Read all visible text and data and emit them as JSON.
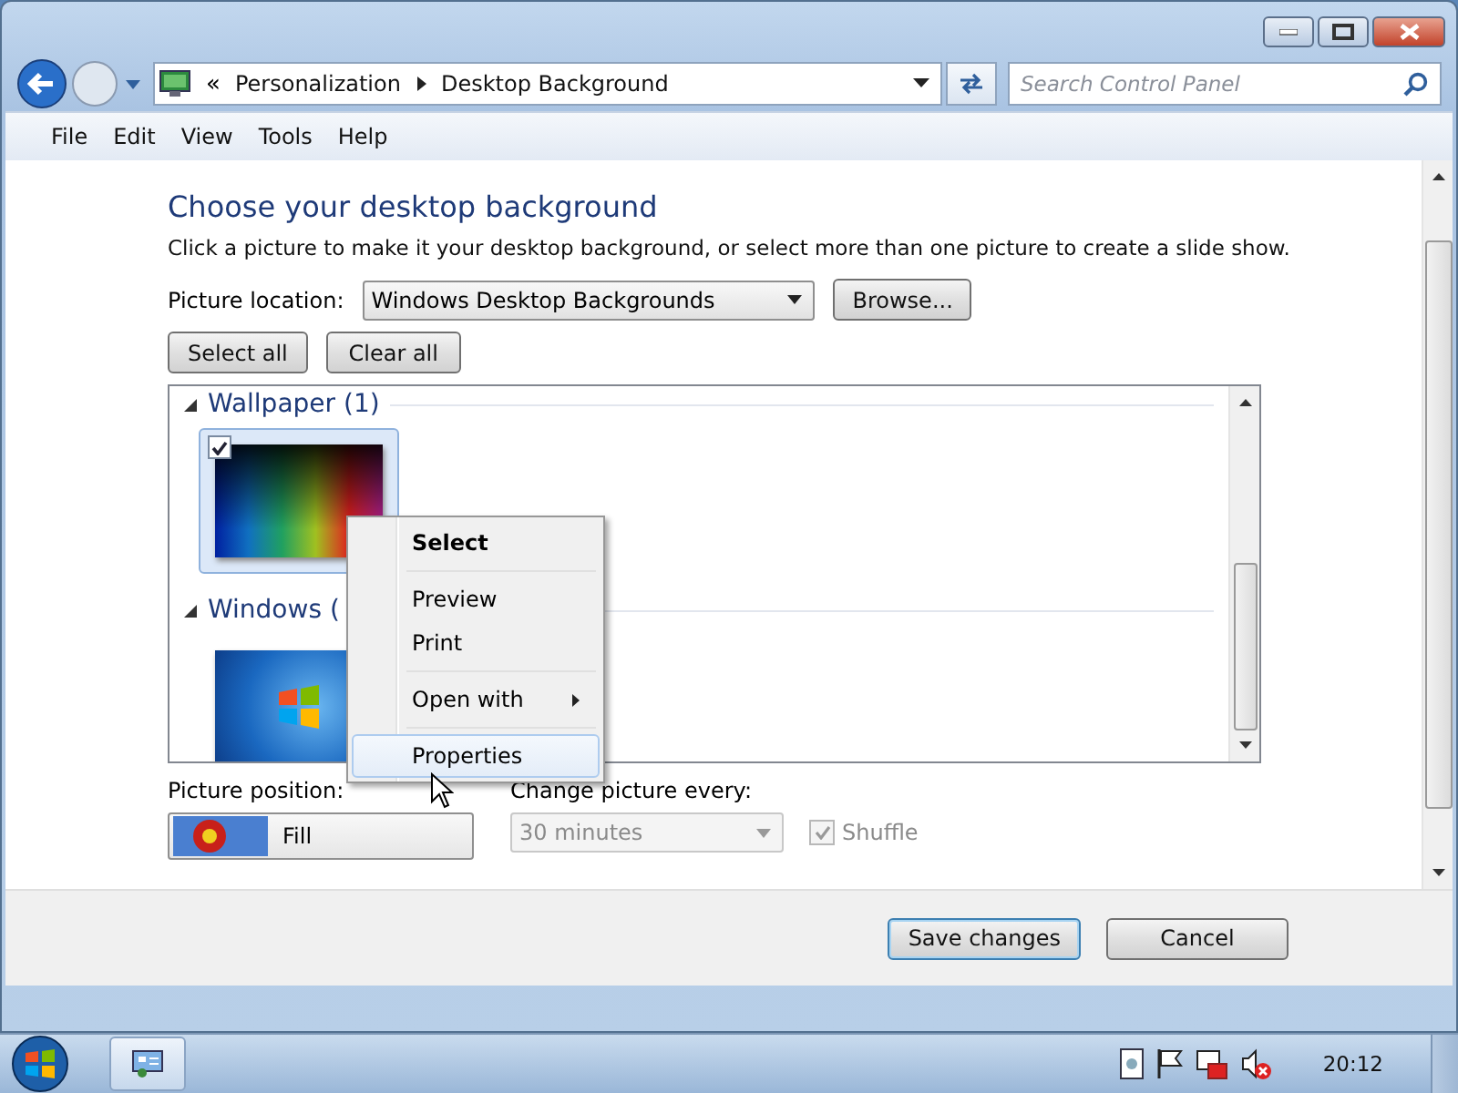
{
  "navigation": {
    "overflow": "«",
    "breadcrumbs": [
      "Personalization",
      "Desktop Background"
    ],
    "search": {
      "placeholder": "Search Control Panel"
    }
  },
  "menu_bar": [
    "File",
    "Edit",
    "View",
    "Tools",
    "Help"
  ],
  "page": {
    "title": "Choose your desktop background",
    "description": "Click a picture to make it your desktop background, or select more than one picture to create a slide show.",
    "picture_location": {
      "label": "Picture location:",
      "value": "Windows Desktop Backgrounds"
    },
    "browse_button": "Browse...",
    "select_buttons": [
      "Select all",
      "Clear all"
    ]
  },
  "gallery": {
    "groups": [
      {
        "title": "Wallpaper (1)",
        "expanded": true,
        "pictures": [
          {
            "kind": "spectrum",
            "checked": true,
            "selected": true
          }
        ]
      },
      {
        "title": "Windows (",
        "expanded": true,
        "pictures": [
          {
            "kind": "windows-logo",
            "checked": false,
            "selected": false
          }
        ]
      }
    ]
  },
  "context_menu": {
    "groups": [
      [
        {
          "label": "Select",
          "default": true,
          "submenu": false,
          "selected": false
        }
      ],
      [
        {
          "label": "Preview",
          "default": false,
          "submenu": false,
          "selected": false
        },
        {
          "label": "Print",
          "default": false,
          "submenu": false,
          "selected": false
        }
      ],
      [
        {
          "label": "Open with",
          "default": false,
          "submenu": true,
          "selected": false
        }
      ],
      [
        {
          "label": "Properties",
          "default": false,
          "submenu": false,
          "selected": true
        }
      ]
    ]
  },
  "options": {
    "position": {
      "label": "Picture position:",
      "value": "Fill"
    },
    "interval": {
      "label": "Change picture every:",
      "value": "30 minutes",
      "disabled": true
    },
    "shuffle": {
      "label": "Shuffle",
      "checked": true,
      "disabled": true
    }
  },
  "footer_buttons": [
    {
      "label": "Save changes",
      "default": true
    },
    {
      "label": "Cancel",
      "default": false
    }
  ],
  "taskbar": {
    "clock": "20:12"
  }
}
